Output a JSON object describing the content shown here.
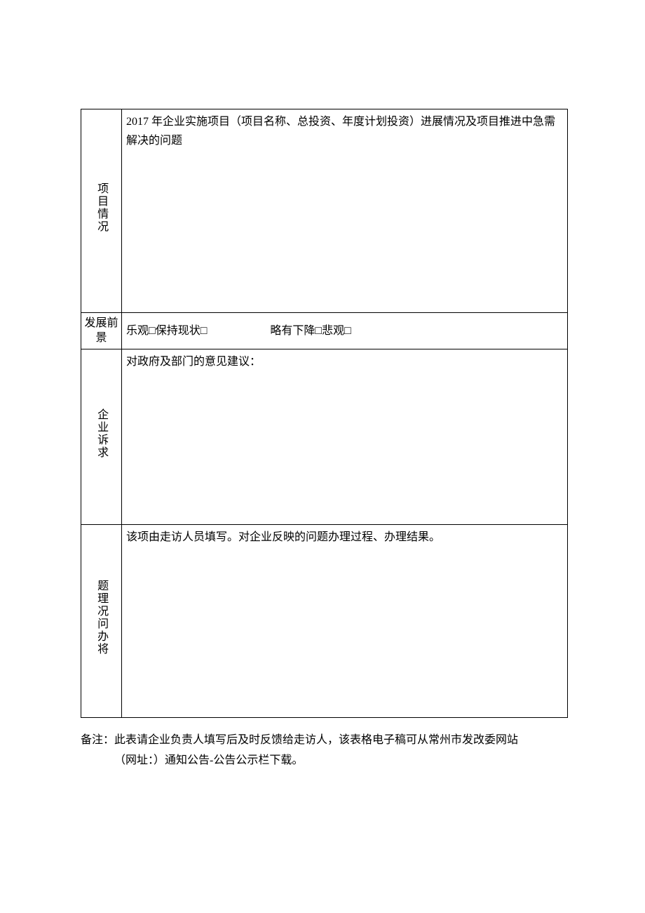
{
  "rows": {
    "project": {
      "label": "项目情况",
      "content": "2017 年企业实施项目（项目名称、总投资、年度计划投资）进展情况及项目推进中急需解决的问题"
    },
    "outlook": {
      "label": "发展前景",
      "options": {
        "optimistic": "乐观",
        "maintain": "保持现状",
        "decline": "略有下降",
        "pessimistic": "悲观"
      },
      "checkbox": "□"
    },
    "demand": {
      "label": "企业诉求",
      "content": "对政府及部门的意见建议："
    },
    "handling": {
      "label": "题理况问办将",
      "content": "该项由走访人员填写。对企业反映的问题办理过程、办理结果。"
    }
  },
  "footnote": {
    "line1": "备注：此表请企业负责人填写后及时反馈给走访人，该表格电子稿可从常州市发改委网站",
    "line2": "（网址：）通知公告-公告公示栏下载。"
  }
}
